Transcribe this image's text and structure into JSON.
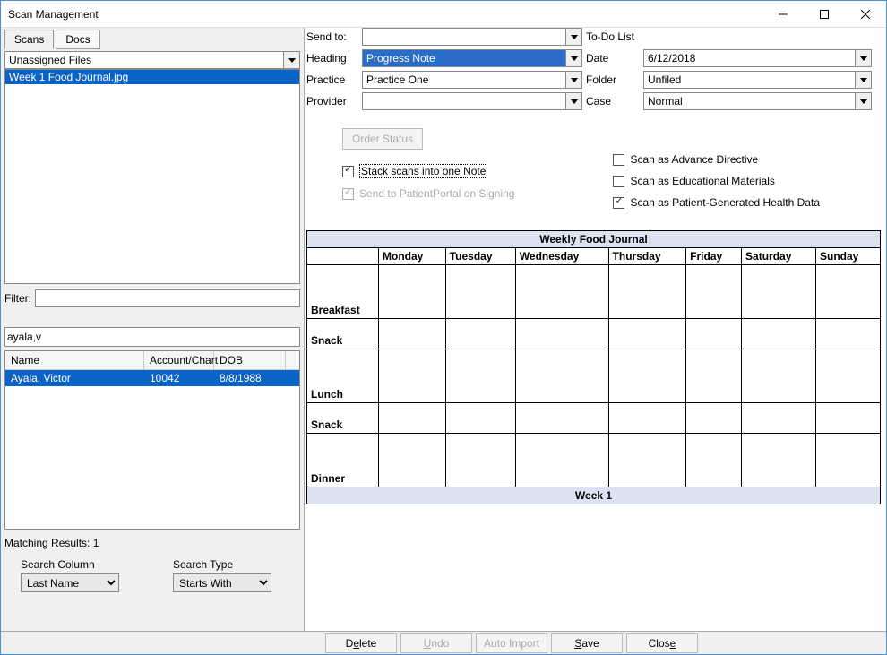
{
  "window": {
    "title": "Scan Management"
  },
  "tabs": {
    "scans": "Scans",
    "docs": "Docs"
  },
  "filesCombo": {
    "value": "Unassigned Files"
  },
  "fileList": {
    "item0": "Week 1 Food Journal.jpg"
  },
  "filter": {
    "label": "Filter:",
    "value": ""
  },
  "search": {
    "value": "ayala,v"
  },
  "results": {
    "cols": {
      "name": "Name",
      "acct": "Account/Chart",
      "dob": "DOB"
    },
    "row0": {
      "name": "Ayala, Victor",
      "acct": "10042",
      "dob": "8/8/1988"
    }
  },
  "match": {
    "label": "Matching Results: 1"
  },
  "searchOpts": {
    "colLabel": "Search Column",
    "colValue": "Last Name",
    "typeLabel": "Search Type",
    "typeValue": "Starts With"
  },
  "form": {
    "sendto_l": "Send to:",
    "sendto_v": "",
    "todo_l": "To-Do List",
    "heading_l": "Heading",
    "heading_v": "Progress Note",
    "date_l": "Date",
    "date_v": "6/12/2018",
    "practice_l": "Practice",
    "practice_v": "Practice One",
    "folder_l": "Folder",
    "folder_v": "Unfiled",
    "provider_l": "Provider",
    "provider_v": "",
    "case_l": "Case",
    "case_v": "Normal"
  },
  "opts": {
    "orderStatus": "Order Status",
    "stack": "Stack scans into one Note",
    "portal": "Send to PatientPortal on Signing",
    "adv": "Scan as Advance Directive",
    "edu": "Scan as Educational Materials",
    "phd": "Scan as Patient-Generated Health Data"
  },
  "journal": {
    "title": "Weekly Food Journal",
    "days": {
      "mon": "Monday",
      "tue": "Tuesday",
      "wed": "Wednesday",
      "thu": "Thursday",
      "fri": "Friday",
      "sat": "Saturday",
      "sun": "Sunday"
    },
    "rows": {
      "breakfast": "Breakfast",
      "snack1": "Snack",
      "lunch": "Lunch",
      "snack2": "Snack",
      "dinner": "Dinner"
    },
    "footer": "Week 1"
  },
  "buttons": {
    "delete_pre": "D",
    "delete_u": "e",
    "delete_post": "lete",
    "undo_pre": "",
    "undo_u": "U",
    "undo_post": "ndo",
    "auto": "Auto Import",
    "save_pre": "",
    "save_u": "S",
    "save_post": "ave",
    "close_pre": "Clos",
    "close_u": "e",
    "close_post": ""
  }
}
